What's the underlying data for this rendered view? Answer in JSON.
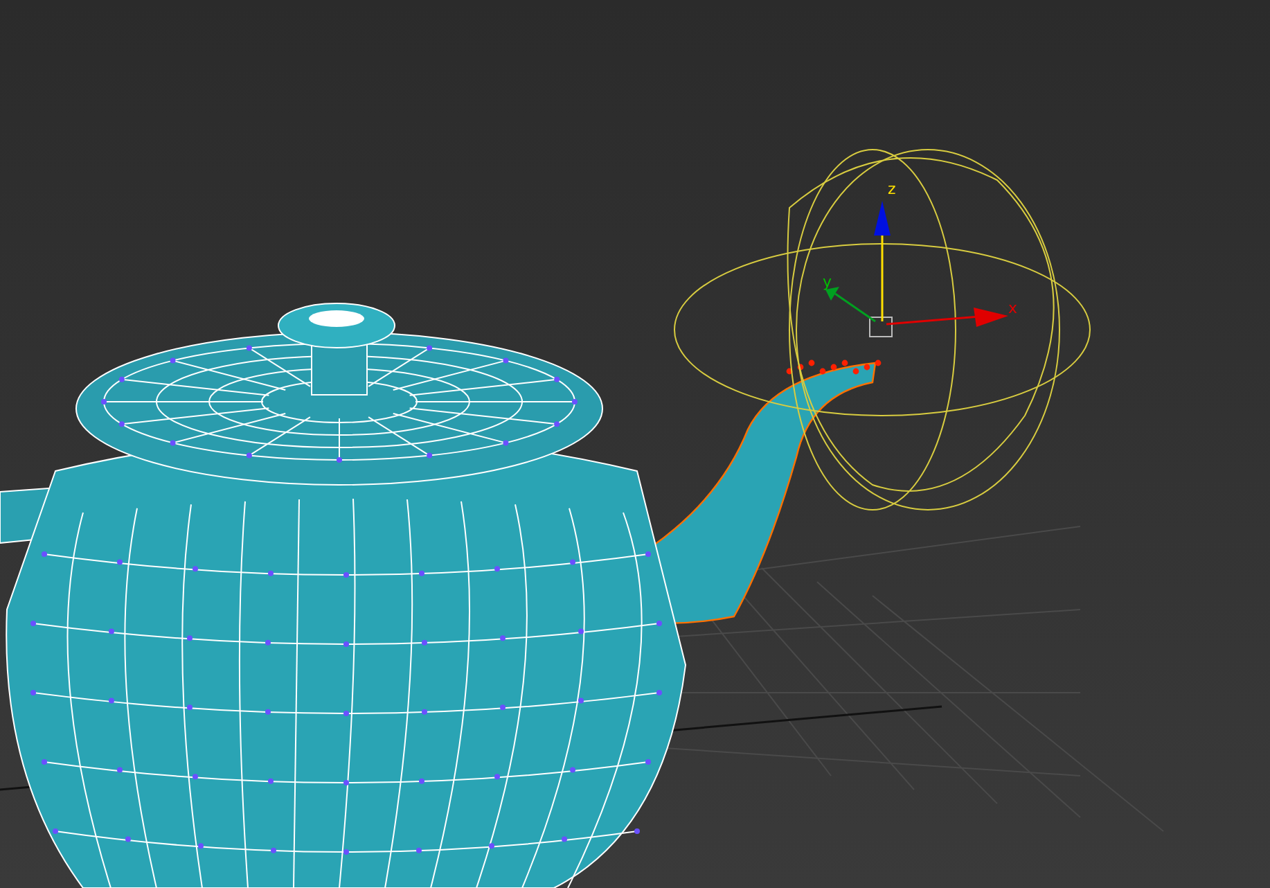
{
  "viewport": {
    "gizmo": {
      "axes": [
        {
          "label": "z",
          "color": "#0010e0"
        },
        {
          "label": "y",
          "color": "#00a020"
        },
        {
          "label": "x",
          "color": "#e00000"
        }
      ]
    }
  }
}
